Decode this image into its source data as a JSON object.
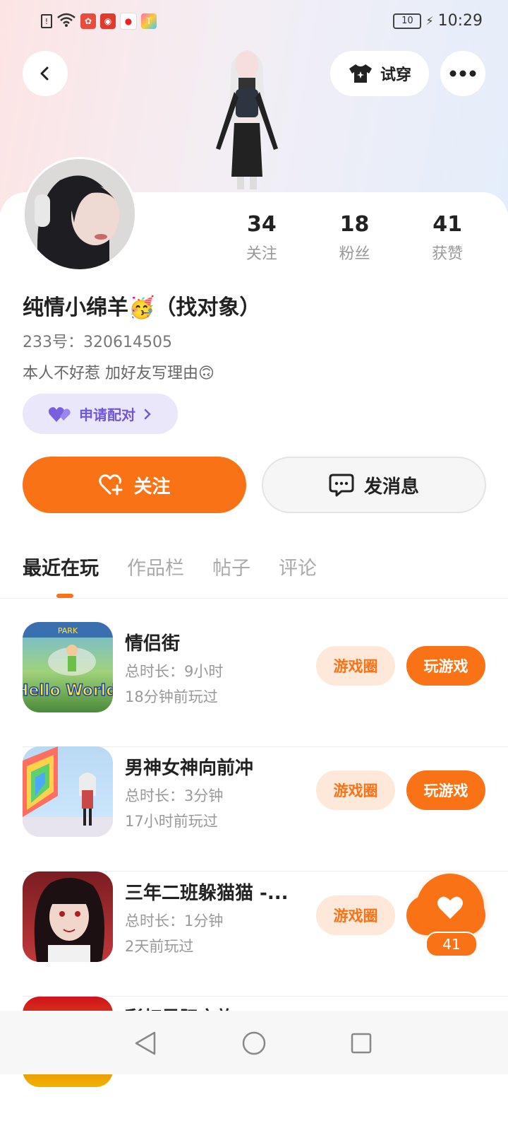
{
  "status_bar": {
    "time": "10:29",
    "battery": "10"
  },
  "header": {
    "try_on_label": "试穿"
  },
  "stats": [
    {
      "value": "34",
      "label": "关注"
    },
    {
      "value": "18",
      "label": "粉丝"
    },
    {
      "value": "41",
      "label": "获赞"
    }
  ],
  "profile": {
    "name": "纯情小绵羊🥳（找对象）",
    "uid": "233号：320614505",
    "bio": "本人不好惹  加好友写理由🙃",
    "pair_label": "申请配对"
  },
  "actions": {
    "follow_label": "关注",
    "message_label": "发消息"
  },
  "tabs": [
    {
      "label": "最近在玩"
    },
    {
      "label": "作品栏"
    },
    {
      "label": "帖子"
    },
    {
      "label": "评论"
    }
  ],
  "games": [
    {
      "title": "情侣街",
      "duration": "总时长：9小时",
      "last_played": "18分钟前玩过",
      "circle_label": "游戏圈",
      "play_label": "玩游戏",
      "icon_text": "Hello World",
      "icon_top_text": "PARK"
    },
    {
      "title": "男神女神向前冲",
      "duration": "总时长：3分钟",
      "last_played": "17小时前玩过",
      "circle_label": "游戏圈",
      "play_label": "玩游戏"
    },
    {
      "title": "三年二班躲猫猫 -...",
      "duration": "总时长：1分钟",
      "last_played": "2天前玩过",
      "circle_label": "游戏圈",
      "play_label": "玩游戏"
    },
    {
      "title": "彩虹星际之旅"
    }
  ],
  "floating_like": {
    "count": "41"
  },
  "colors": {
    "accent": "#f97316",
    "pair_purple": "#7257d6"
  }
}
